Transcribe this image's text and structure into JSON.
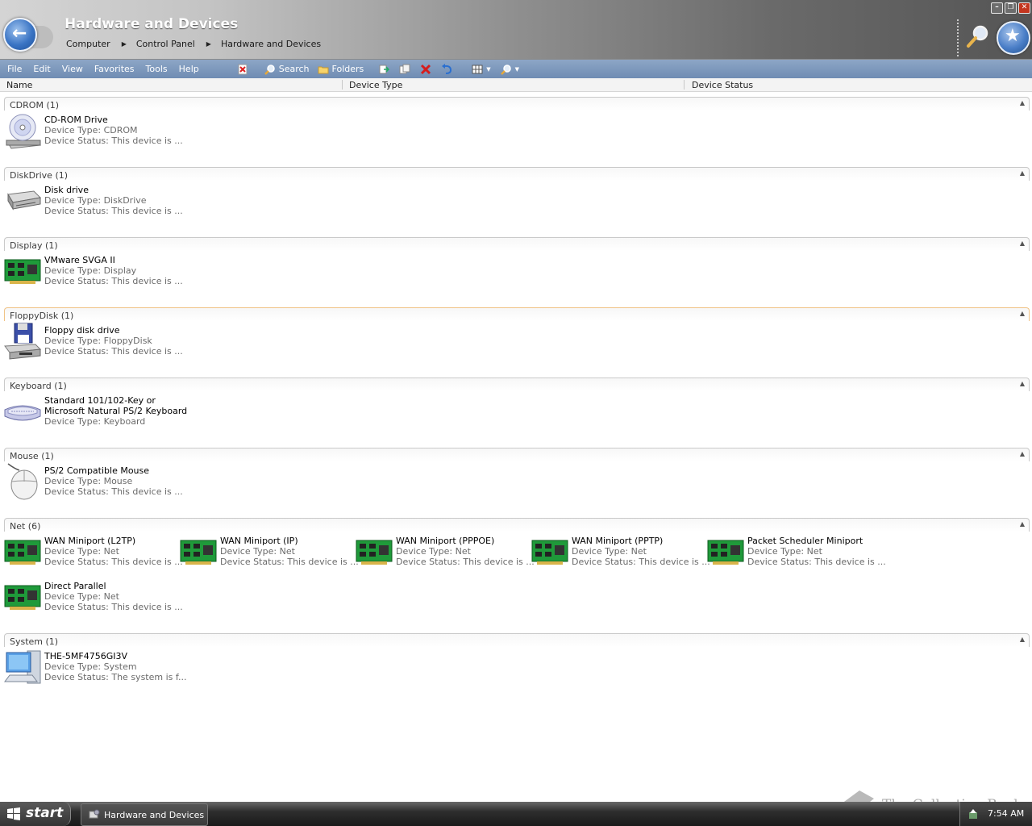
{
  "window": {
    "title": "Hardware and Devices",
    "breadcrumb": [
      "Computer",
      "Control Panel",
      "Hardware and Devices"
    ]
  },
  "menu": [
    "File",
    "Edit",
    "View",
    "Favorites",
    "Tools",
    "Help"
  ],
  "toolbar": {
    "search": "Search",
    "folders": "Folders"
  },
  "columns": [
    "Name",
    "Device Type",
    "Device Status"
  ],
  "groups": [
    {
      "title": "CDROM (1)",
      "items": [
        {
          "name": "CD-ROM Drive",
          "type": "Device Type: CDROM",
          "status": "Device Status: This device is ...",
          "icon": "cdrom-icon"
        }
      ]
    },
    {
      "title": "DiskDrive (1)",
      "items": [
        {
          "name": "Disk drive",
          "type": "Device Type: DiskDrive",
          "status": "Device Status: This device is ...",
          "icon": "disk-drive-icon"
        }
      ]
    },
    {
      "title": "Display (1)",
      "items": [
        {
          "name": "VMware SVGA II",
          "type": "Device Type: Display",
          "status": "Device Status: This device is ...",
          "icon": "circuit-board-icon"
        }
      ]
    },
    {
      "title": "FloppyDisk (1)",
      "items": [
        {
          "name": "Floppy disk drive",
          "type": "Device Type: FloppyDisk",
          "status": "Device Status: This device is ...",
          "icon": "floppy-drive-icon"
        }
      ]
    },
    {
      "title": "Keyboard (1)",
      "items": [
        {
          "name": "Standard 101/102-Key or",
          "type": "Microsoft Natural PS/2 Keyboard",
          "status": "Device Type: Keyboard",
          "icon": "keyboard-icon"
        }
      ]
    },
    {
      "title": "Mouse (1)",
      "items": [
        {
          "name": "PS/2 Compatible Mouse",
          "type": "Device Type: Mouse",
          "status": "Device Status: This device is ...",
          "icon": "mouse-icon"
        }
      ]
    },
    {
      "title": "Net (6)",
      "items": [
        {
          "name": "WAN Miniport (L2TP)",
          "type": "Device Type: Net",
          "status": "Device Status: This device is ...",
          "icon": "circuit-board-icon"
        },
        {
          "name": "WAN Miniport (IP)",
          "type": "Device Type: Net",
          "status": "Device Status: This device is ...",
          "icon": "circuit-board-icon"
        },
        {
          "name": "WAN Miniport (PPPOE)",
          "type": "Device Type: Net",
          "status": "Device Status: This device is ...",
          "icon": "circuit-board-icon"
        },
        {
          "name": "WAN Miniport (PPTP)",
          "type": "Device Type: Net",
          "status": "Device Status: This device is ...",
          "icon": "circuit-board-icon"
        },
        {
          "name": "Packet Scheduler Miniport",
          "type": "Device Type: Net",
          "status": "Device Status: This device is ...",
          "icon": "circuit-board-icon"
        },
        {
          "name": "Direct Parallel",
          "type": "Device Type: Net",
          "status": "Device Status: This device is ...",
          "icon": "circuit-board-icon"
        }
      ]
    },
    {
      "title": "System (1)",
      "items": [
        {
          "name": "THE-5MF4756GI3V",
          "type": "Device Type: System",
          "status": "Device Status: The system is f...",
          "icon": "computer-icon"
        }
      ]
    }
  ],
  "taskbar": {
    "start": "start",
    "window": "Hardware and Devices",
    "clock": "7:54 AM"
  },
  "watermark": "The Collection Book"
}
